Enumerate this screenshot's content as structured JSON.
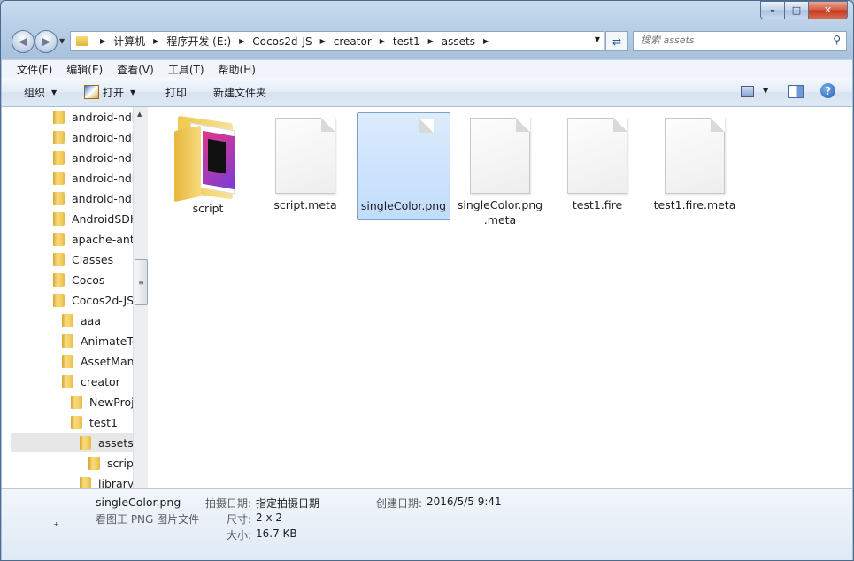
{
  "address": {
    "crumbs": [
      "计算机",
      "程序开发 (E:)",
      "Cocos2d-JS",
      "creator",
      "test1",
      "assets"
    ]
  },
  "search": {
    "placeholder": "搜索 assets"
  },
  "menu": [
    "文件(F)",
    "编辑(E)",
    "查看(V)",
    "工具(T)",
    "帮助(H)"
  ],
  "toolbar": {
    "organize": "组织",
    "open": "打开",
    "print": "打印",
    "new_folder": "新建文件夹"
  },
  "tree": [
    "android-ndk",
    "android-ndk",
    "android-ndk",
    "android-ndk",
    "android-ndk",
    "AndroidSDK",
    "apache-ant-",
    "Classes",
    "Cocos",
    "Cocos2d-JS",
    "aaa",
    "AnimateTe",
    "AssetMana",
    "creator",
    "NewProj",
    "test1",
    "assets",
    "script",
    "library"
  ],
  "files": [
    {
      "name": "script",
      "kind": "folder"
    },
    {
      "name": "script.meta",
      "kind": "doc"
    },
    {
      "name": "singleColor.png",
      "kind": "doc",
      "selected": true
    },
    {
      "name": "singleColor.png\n.meta",
      "kind": "doc"
    },
    {
      "name": "test1.fire",
      "kind": "doc"
    },
    {
      "name": "test1.fire.meta",
      "kind": "doc"
    }
  ],
  "details": {
    "name": "singleColor.png",
    "type": "看图王 PNG 图片文件",
    "date_taken_label": "拍摄日期:",
    "date_taken_value": "指定拍摄日期",
    "created_label": "创建日期:",
    "created_value": "2016/5/5 9:41",
    "dimensions_label": "尺寸:",
    "dimensions_value": "2 x 2",
    "size_label": "大小:",
    "size_value": "16.7 KB"
  }
}
